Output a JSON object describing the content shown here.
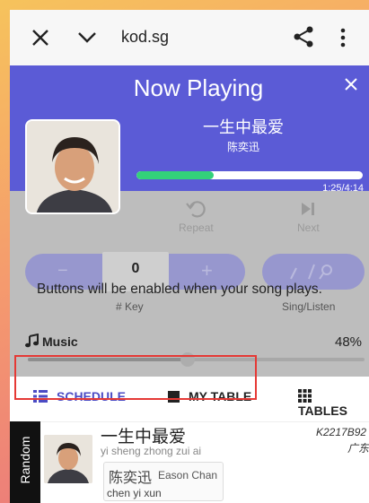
{
  "browser": {
    "url": "kod.sg",
    "close_icon": "close-icon",
    "chevron_icon": "chevron-down-icon",
    "share_icon": "share-icon",
    "more_icon": "more-vert-icon"
  },
  "now_playing": {
    "title": "Now Playing",
    "song": "一生中最爱",
    "artist": "陈奕迅",
    "progress": 0.34,
    "time": "1:25/4:14",
    "accent": "#5b5bd6",
    "progress_color": "#33d17a"
  },
  "controls": {
    "repeat_label": "Repeat",
    "next_label": "Next",
    "minus": "−",
    "plus": "+",
    "key_value": "0",
    "key_label": "# Key",
    "sing_listen_label": "Sing/Listen",
    "notice": "Buttons will be enabled when your song plays.",
    "music_label": "Music",
    "music_percent": "48%",
    "volume": 0.48
  },
  "tabs": {
    "schedule": "SCHEDULE",
    "my_table": "MY TABLE",
    "tables": "TABLES"
  },
  "list_item": {
    "badge": "Random",
    "title": "一生中最爱",
    "pinyin": "yi sheng zhong zui ai",
    "artist_cn": "陈奕迅",
    "artist_en": "Eason Chan",
    "artist_pinyin": "chen yi xun",
    "code": "K2217B92",
    "region": "广东"
  }
}
